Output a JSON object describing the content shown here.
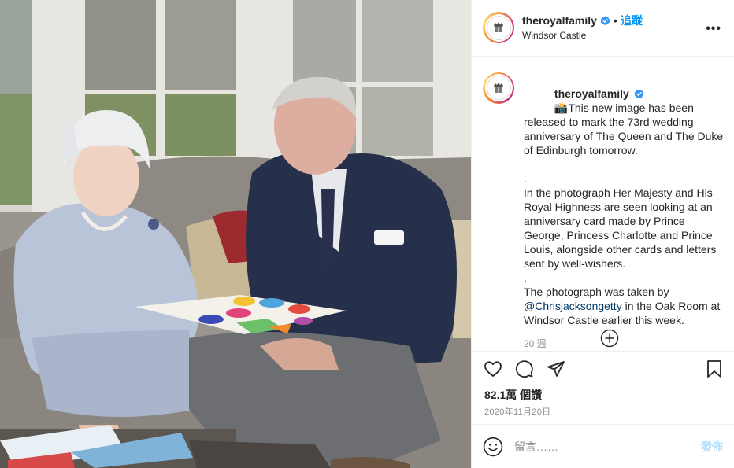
{
  "post": {
    "username": "theroyalfamily",
    "verified": true,
    "follow_separator": "•",
    "follow_label": "追蹤",
    "location": "Windsor Castle",
    "more_icon": "more-horizontal-icon",
    "caption_emoji": "📸",
    "caption_lines": [
      "This new image has been released to mark the 73rd wedding anniversary of The Queen and The Duke of Edinburgh tomorrow.",
      ".",
      "In the photograph Her Majesty and His Royal Highness are seen looking at an anniversary card made by Prince George, Princess Charlotte and Prince Louis, alongside other cards and letters sent by well-wishers.",
      "."
    ],
    "caption_tail_before": "The photograph was taken by ",
    "caption_mention": "@Chrisjacksongetty",
    "caption_tail_after": " in the Oak Room at Windsor Castle earlier this week.",
    "caption_age": "20 週",
    "load_more_icon": "plus-circle-icon",
    "likes_text": "82.1萬 個讚",
    "date": "2020年11月20日",
    "comment_placeholder": "留言……",
    "post_button": "發佈"
  },
  "icons": {
    "like": "heart-icon",
    "comment": "comment-icon",
    "share": "paper-plane-icon",
    "save": "bookmark-icon",
    "emoji": "smiley-icon",
    "verified": "verified-badge-icon"
  },
  "colors": {
    "link": "#0095f6",
    "mention": "#00376b",
    "muted": "#8e8e8e",
    "post_disabled": "#b2dffc"
  }
}
